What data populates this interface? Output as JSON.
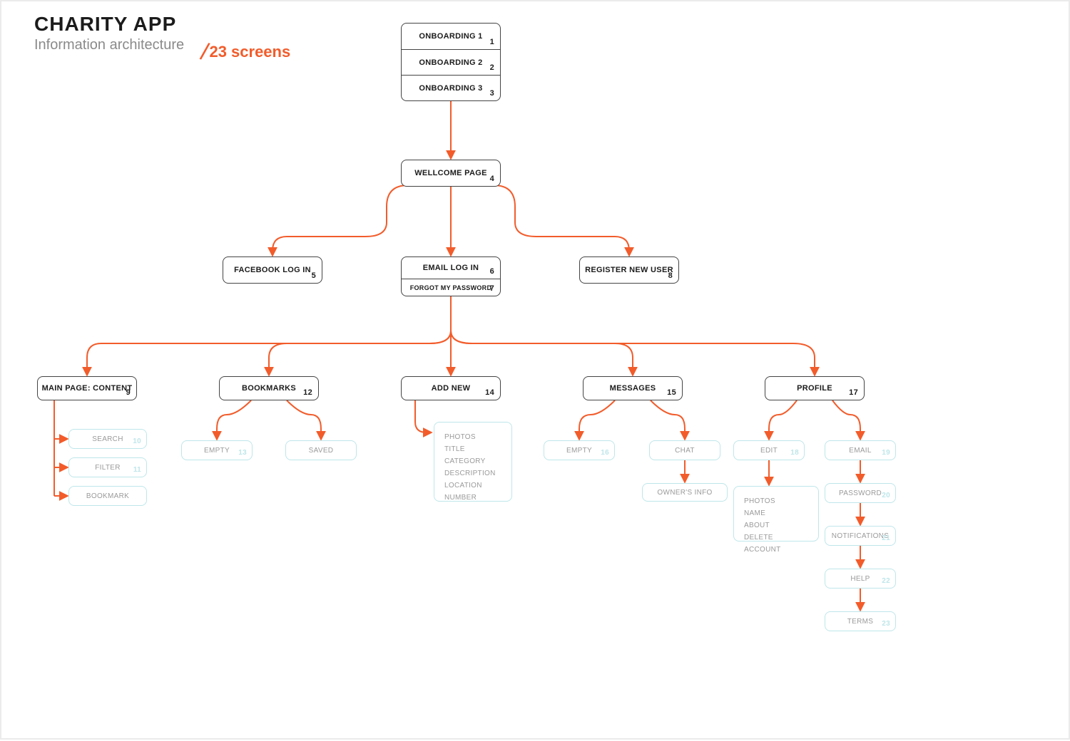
{
  "header": {
    "title": "CHARITY APP",
    "subtitle": "Information architecture"
  },
  "count": {
    "slash": "/",
    "text": "23 screens"
  },
  "nodes": {
    "onb1": {
      "label": "ONBOARDING 1",
      "num": "1"
    },
    "onb2": {
      "label": "ONBOARDING 2",
      "num": "2"
    },
    "onb3": {
      "label": "ONBOARDING 3",
      "num": "3"
    },
    "welcome": {
      "label": "WELLCOME PAGE",
      "num": "4"
    },
    "fblogin": {
      "label": "FACEBOOK LOG IN",
      "num": "5"
    },
    "emaillogin": {
      "label": "EMAIL LOG IN",
      "num": "6"
    },
    "forgot": {
      "label": "FORGOT MY PASSWORD",
      "num": "7"
    },
    "register": {
      "label": "REGISTER NEW USER",
      "num": "8"
    },
    "main": {
      "label": "MAIN PAGE: CONTENT",
      "num": "9"
    },
    "bookmarks": {
      "label": "BOOKMARKS",
      "num": "12"
    },
    "addnew": {
      "label": "ADD NEW",
      "num": "14"
    },
    "messages": {
      "label": "MESSAGES",
      "num": "15"
    },
    "profile": {
      "label": "PROFILE",
      "num": "17"
    }
  },
  "subs": {
    "search": {
      "label": "SEARCH",
      "num": "10"
    },
    "filter": {
      "label": "FILTER",
      "num": "11"
    },
    "bookmark": {
      "label": "BOOKMARK",
      "num": ""
    },
    "bm_empty": {
      "label": "EMPTY",
      "num": "13"
    },
    "bm_saved": {
      "label": "SAVED",
      "num": ""
    },
    "addnew_fields": {
      "items": [
        "PHOTOS",
        "TITLE",
        "CATEGORY",
        "DESCRIPTION",
        "LOCATION",
        "NUMBER"
      ]
    },
    "msg_empty": {
      "label": "EMPTY",
      "num": "16"
    },
    "msg_chat": {
      "label": "CHAT",
      "num": ""
    },
    "owner": {
      "label": "OWNER'S INFO",
      "num": ""
    },
    "edit": {
      "label": "EDIT",
      "num": "18"
    },
    "edit_fields": {
      "items": [
        "PHOTOS",
        "NAME",
        "ABOUT",
        "DELETE ACCOUNT"
      ]
    },
    "email": {
      "label": "EMAIL",
      "num": "19"
    },
    "password": {
      "label": "PASSWORD",
      "num": "20"
    },
    "notif": {
      "label": "NOTIFICATIONS",
      "num": "21"
    },
    "help": {
      "label": "HELP",
      "num": "22"
    },
    "terms": {
      "label": "TERMS",
      "num": "23"
    }
  }
}
